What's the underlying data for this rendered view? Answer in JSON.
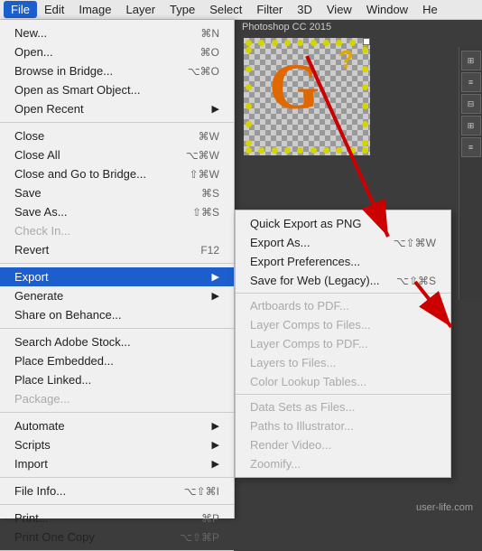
{
  "menubar": {
    "items": [
      {
        "label": "File",
        "active": true
      },
      {
        "label": "Edit"
      },
      {
        "label": "Image"
      },
      {
        "label": "Layer"
      },
      {
        "label": "Type"
      },
      {
        "label": "Select"
      },
      {
        "label": "Filter"
      },
      {
        "label": "3D"
      },
      {
        "label": "View"
      },
      {
        "label": "Window"
      },
      {
        "label": "He"
      }
    ]
  },
  "app_subtitle": "Photoshop CC 2015",
  "file_menu": {
    "sections": [
      {
        "items": [
          {
            "label": "New...",
            "shortcut": "⌘N"
          },
          {
            "label": "Open...",
            "shortcut": "⌘O"
          },
          {
            "label": "Browse in Bridge...",
            "shortcut": "⌥⌘O"
          },
          {
            "label": "Open as Smart Object..."
          },
          {
            "label": "Open Recent",
            "hasSubmenu": true
          }
        ]
      },
      {
        "items": [
          {
            "label": "Close",
            "shortcut": "⌘W"
          },
          {
            "label": "Close All",
            "shortcut": "⌥⌘W"
          },
          {
            "label": "Close and Go to Bridge...",
            "shortcut": "⇧⌘W"
          },
          {
            "label": "Save",
            "shortcut": "⌘S"
          },
          {
            "label": "Save As...",
            "shortcut": "⇧⌘S"
          },
          {
            "label": "Check In...",
            "disabled": true
          },
          {
            "label": "Revert",
            "shortcut": "F12"
          }
        ]
      },
      {
        "items": [
          {
            "label": "Export",
            "highlighted": true,
            "hasSubmenu": true
          },
          {
            "label": "Generate",
            "hasSubmenu": true
          },
          {
            "label": "Share on Behance..."
          }
        ]
      },
      {
        "items": [
          {
            "label": "Search Adobe Stock..."
          },
          {
            "label": "Place Embedded..."
          },
          {
            "label": "Place Linked..."
          },
          {
            "label": "Package...",
            "disabled": true
          }
        ]
      },
      {
        "items": [
          {
            "label": "Automate",
            "hasSubmenu": true
          },
          {
            "label": "Scripts",
            "hasSubmenu": true
          },
          {
            "label": "Import",
            "hasSubmenu": true
          }
        ]
      },
      {
        "items": [
          {
            "label": "File Info...",
            "shortcut": "⌥⇧⌘I"
          }
        ]
      },
      {
        "items": [
          {
            "label": "Print...",
            "shortcut": "⌘P"
          },
          {
            "label": "Print One Copy",
            "shortcut": "⌥⇧⌘P"
          }
        ]
      }
    ]
  },
  "export_submenu": {
    "items": [
      {
        "label": "Quick Export as PNG"
      },
      {
        "label": "Export As...",
        "shortcut": "⌥⇧⌘W"
      },
      {
        "label": "Export Preferences...",
        "arrow_indicator": true
      },
      {
        "label": "Save for Web (Legacy)...",
        "shortcut": "⌥⇧⌘S"
      }
    ],
    "separator_after": 3,
    "disabled_items": [
      {
        "label": "Artboards to PDF..."
      },
      {
        "label": "Layer Comps to Files..."
      },
      {
        "label": "Layer Comps to PDF..."
      },
      {
        "label": "Layers to Files..."
      },
      {
        "label": "Color Lookup Tables..."
      }
    ],
    "separator_after_2": 8,
    "disabled_items_2": [
      {
        "label": "Data Sets as Files..."
      },
      {
        "label": "Paths to Illustrator..."
      },
      {
        "label": "Render Video..."
      },
      {
        "label": "Zoomify..."
      }
    ]
  },
  "canvas": {
    "letter": "G",
    "question_mark": "?"
  },
  "watermark": "user-life.com"
}
